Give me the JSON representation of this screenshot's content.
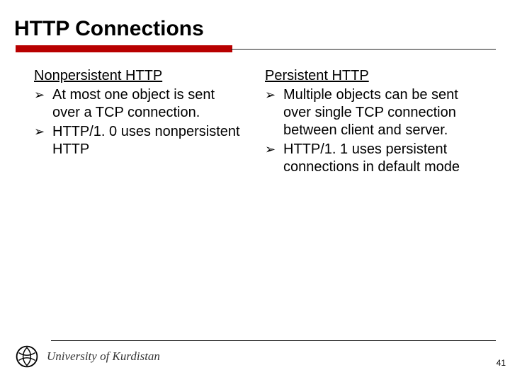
{
  "title": "HTTP Connections",
  "left": {
    "heading": "Nonpersistent HTTP",
    "bullets": [
      "At most one object is sent over a TCP connection.",
      "HTTP/1. 0 uses nonpersistent HTTP"
    ]
  },
  "right": {
    "heading": "Persistent HTTP",
    "bullets": [
      "Multiple objects can be sent over single TCP connection between client and server.",
      "HTTP/1. 1 uses persistent connections in default mode"
    ]
  },
  "bullet_glyph": "➢",
  "footer": {
    "university": "University of Kurdistan",
    "page": "41"
  }
}
